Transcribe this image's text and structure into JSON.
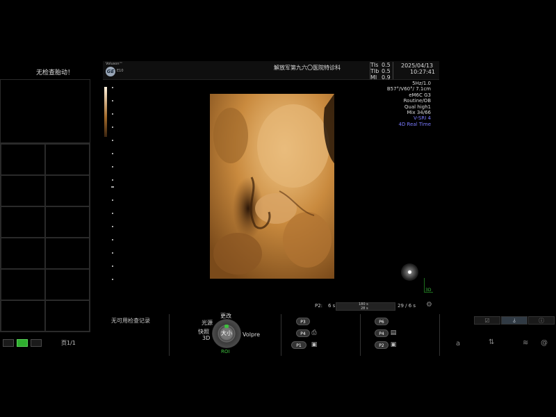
{
  "left_panel": {
    "probe_message": "无检查胎动！",
    "page_indicator": "页1/1"
  },
  "header": {
    "logo_text": "Voluson™",
    "logo_mark": "GE",
    "logo_sub": "E10",
    "hospital": "解放军第九六〇医院特诊科",
    "tis_label": "TIs",
    "tis_value": "0.5",
    "tib_label": "TIb",
    "tib_value": "0.5",
    "mi_label": "MI",
    "mi_value": "0.9",
    "date": "2025/04/13",
    "time": "10:27:41"
  },
  "params": [
    {
      "text": "5Hz/1.0",
      "color": "#dddddd"
    },
    {
      "text": "B57°/V60°/ 7.1cm",
      "color": "#dddddd"
    },
    {
      "text": "eM6C G3",
      "color": "#dddddd"
    },
    {
      "text": "Routine/OB",
      "color": "#dddddd"
    },
    {
      "text": "Qual high1",
      "color": "#dddddd"
    },
    {
      "text": "Mix 34/66",
      "color": "#dddddd"
    },
    {
      "text": "V-SRI 4",
      "color": "#7b7bff"
    },
    {
      "text": "4D Real Time",
      "color": "#7b7bff"
    }
  ],
  "viewport": {
    "axis_label": "3D"
  },
  "scan_bar": {
    "left_label": "P2:",
    "left_value": "6 s",
    "top_value": "180 s",
    "bottom_value": "28 s",
    "right_value": "29 / 6 s"
  },
  "bottom": {
    "no_records": "无可用检查记录",
    "knob": {
      "top": "更改",
      "top_left": "光源",
      "left": "快照",
      "left_sub": "3D",
      "center": "大小",
      "right": "Volpre",
      "bottom": "ROI"
    },
    "preset_group_a": [
      "P3",
      "P4",
      "P1"
    ],
    "preset_group_b": [
      "P6",
      "P4",
      "P2"
    ],
    "right_letter": "a"
  },
  "colors": {
    "accent_green": "#3fbf3f",
    "params_blue": "#7b7bff",
    "render_tone": "#c98a3e"
  }
}
